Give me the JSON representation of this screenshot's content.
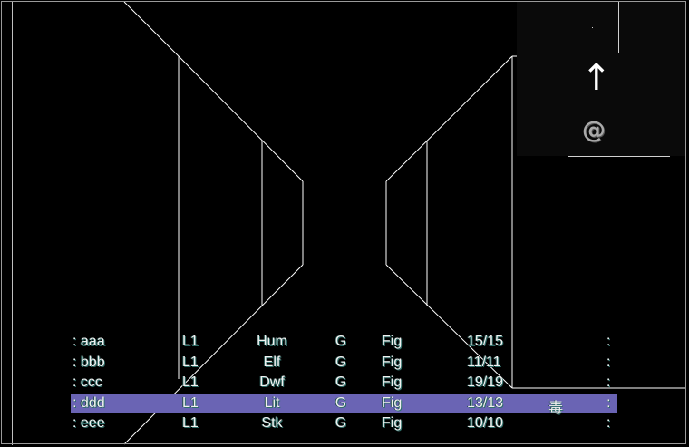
{
  "minimap": {
    "facing_icon": "arrow-up",
    "player_marker_icon": "at-sign",
    "arrow_glyph": "↑",
    "marker_glyph": "@"
  },
  "party": [
    {
      "prefix": ":",
      "name": "aaa",
      "level": "L1",
      "race": "Hum",
      "alignment": "G",
      "class": "Fig",
      "hp": "15/15",
      "status": "",
      "end": ":"
    },
    {
      "prefix": ":",
      "name": "bbb",
      "level": "L1",
      "race": "Elf",
      "alignment": "G",
      "class": "Fig",
      "hp": "11/11",
      "status": "",
      "end": ":"
    },
    {
      "prefix": ":",
      "name": "ccc",
      "level": "L1",
      "race": "Dwf",
      "alignment": "G",
      "class": "Fig",
      "hp": "19/19",
      "status": "",
      "end": ":"
    },
    {
      "prefix": ":",
      "name": "ddd",
      "level": "L1",
      "race": "Lit",
      "alignment": "G",
      "class": "Fig",
      "hp": "13/13",
      "status": "毒",
      "end": ":",
      "selected": true
    },
    {
      "prefix": ":",
      "name": "eee",
      "level": "L1",
      "race": "Stk",
      "alignment": "G",
      "class": "Fig",
      "hp": "10/10",
      "status": "",
      "end": ":"
    }
  ],
  "colors": {
    "selected_row": "#6a64b4",
    "wireframe": "#ffffff",
    "text": "#f0f0f0"
  }
}
